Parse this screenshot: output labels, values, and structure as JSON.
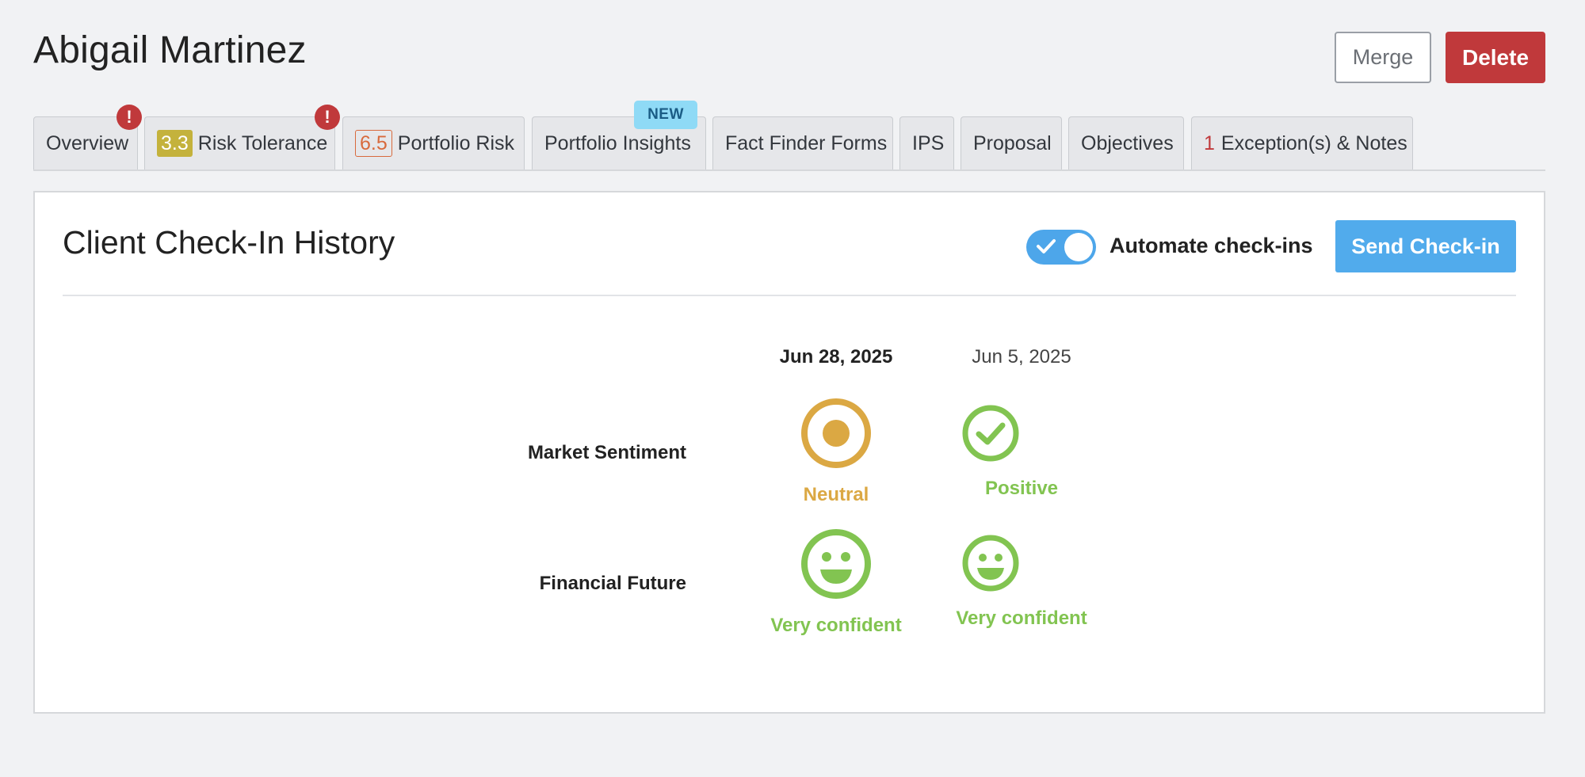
{
  "header": {
    "client_name": "Abigail Martinez",
    "merge_label": "Merge",
    "delete_label": "Delete"
  },
  "tabs": [
    {
      "label": "Overview",
      "alert": true
    },
    {
      "label": "Risk Tolerance",
      "score": "3.3",
      "alert": true
    },
    {
      "label": "Portfolio Risk",
      "score": "6.5"
    },
    {
      "label": "Portfolio Insights",
      "badge": "NEW"
    },
    {
      "label": "Fact Finder Forms"
    },
    {
      "label": "IPS"
    },
    {
      "label": "Proposal"
    },
    {
      "label": "Objectives"
    },
    {
      "label": "Exception(s) & Notes",
      "count": "1"
    }
  ],
  "alert_glyph": "!",
  "checkin": {
    "title": "Client Check-In History",
    "automate_label": "Automate check-ins",
    "automate_enabled": true,
    "send_label": "Send Check-in",
    "dates": [
      {
        "label": "Jun 28, 2025",
        "current": true
      },
      {
        "label": "Jun 5, 2025",
        "current": false
      }
    ],
    "rows": [
      {
        "label": "Market Sentiment",
        "values": [
          {
            "status": "Neutral",
            "icon": "neutral-target-icon",
            "color": "#dba843"
          },
          {
            "status": "Positive",
            "icon": "check-circle-icon",
            "color": "#82c451"
          }
        ]
      },
      {
        "label": "Financial Future",
        "values": [
          {
            "status": "Very confident",
            "icon": "smile-face-icon",
            "color": "#82c451"
          },
          {
            "status": "Very confident",
            "icon": "smile-face-icon",
            "color": "#82c451"
          }
        ]
      }
    ]
  },
  "colors": {
    "background": "#f1f2f4",
    "danger": "#c0393b",
    "primary": "#51abec",
    "neutral": "#dba843",
    "positive": "#82c451",
    "badge_new": "#8fdaf6",
    "badge_score_yellow": "#c4b23c",
    "badge_score_orange": "#d86a3d"
  }
}
